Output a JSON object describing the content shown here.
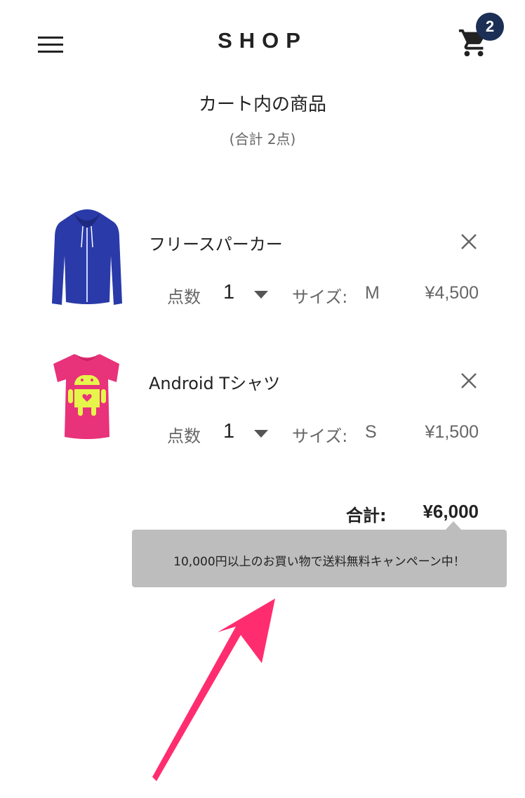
{
  "header": {
    "logo": "SHOP",
    "cart_count": "2",
    "badge_color": "#1c2f55"
  },
  "cart": {
    "title": "カート内の商品",
    "subtitle": "(合計 2点)",
    "quantity_label": "点数",
    "size_label": "サイズ:",
    "items": [
      {
        "name": "フリースパーカー",
        "quantity": "1",
        "size": "M",
        "price": "¥4,500",
        "image_icon": "blue-hoodie-image"
      },
      {
        "name": "Android Tシャツ",
        "quantity": "1",
        "size": "S",
        "price": "¥1,500",
        "image_icon": "pink-android-tshirt-image"
      }
    ],
    "total_label": "合計:",
    "total_value": "¥6,000"
  },
  "tooltip": {
    "text": "10,000円以上のお買い物で送料無料キャンペーン中！",
    "background": "#bdbdbd"
  },
  "annotation": {
    "arrow_color": "#ff2d6f"
  },
  "icons": [
    "hamburger-menu-icon",
    "cart-icon",
    "close-icon",
    "chevron-down-icon"
  ]
}
